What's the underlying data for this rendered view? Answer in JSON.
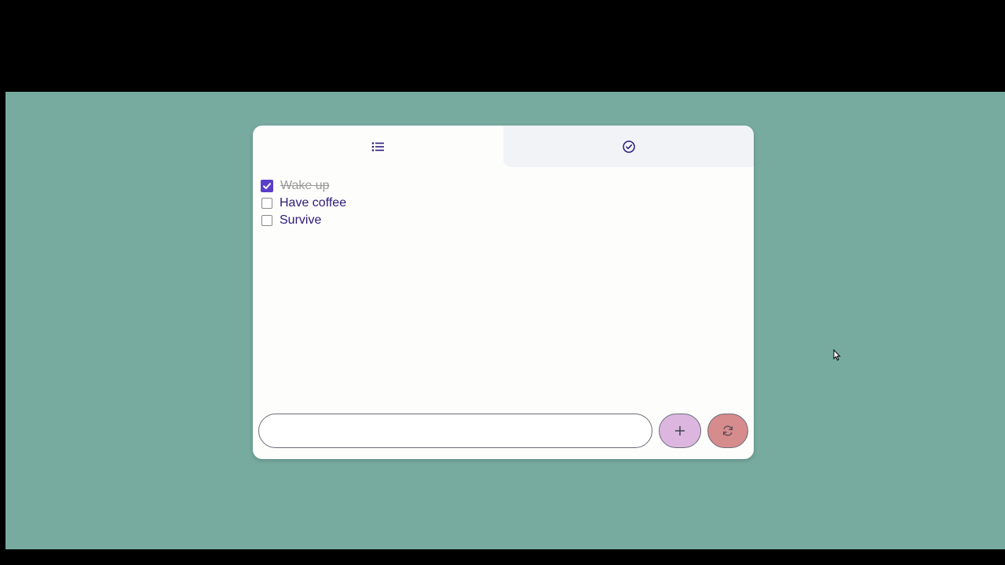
{
  "tabs": [
    {
      "name": "list-icon",
      "active": true
    },
    {
      "name": "check-circle-icon",
      "active": false
    }
  ],
  "todos": [
    {
      "label": "Wake up",
      "checked": true
    },
    {
      "label": "Have coffee",
      "checked": false
    },
    {
      "label": "Survive",
      "checked": false
    }
  ],
  "input": {
    "value": "",
    "placeholder": ""
  },
  "actions": {
    "add_icon": "plus-icon",
    "reset_icon": "refresh-icon"
  },
  "colors": {
    "background": "#78aba0",
    "card": "#fdfdfc",
    "accent": "#5c3fc8",
    "text": "#2e1a7a",
    "add_button": "#dcb6de",
    "reset_button": "#d68c8c"
  }
}
